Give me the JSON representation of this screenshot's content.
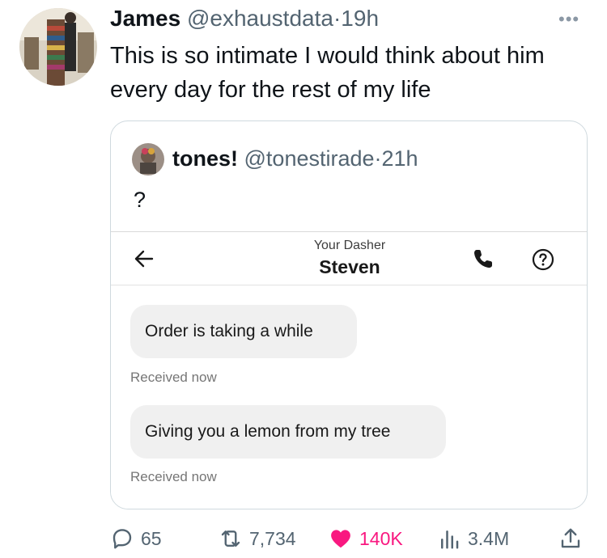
{
  "tweet": {
    "author_name": "James",
    "handle": "@exhaustdata",
    "separator": "·",
    "time": "19h",
    "more_icon": "more-horizontal-icon",
    "text": "This is so intimate I would think about him every day for the rest of my life"
  },
  "quote": {
    "author_name": "tones!",
    "handle": "@tonestirade",
    "separator": "·",
    "time": "21h",
    "text": "?",
    "screenshot": {
      "subtitle": "Your Dasher",
      "title": "Steven",
      "messages": [
        {
          "text": "Order is taking a while",
          "status": "Received now"
        },
        {
          "text": "Giving you a lemon from my tree",
          "status": "Received now"
        }
      ],
      "icons": [
        "back-arrow-icon",
        "phone-icon",
        "help-icon"
      ]
    }
  },
  "actions": {
    "replies": "65",
    "reposts": "7,734",
    "likes": "140K",
    "views": "3.4M"
  },
  "colors": {
    "text": "#0f1419",
    "secondary": "#536471",
    "like": "#f91880",
    "border": "#cfd9de",
    "bubble": "#f0f0f0"
  }
}
